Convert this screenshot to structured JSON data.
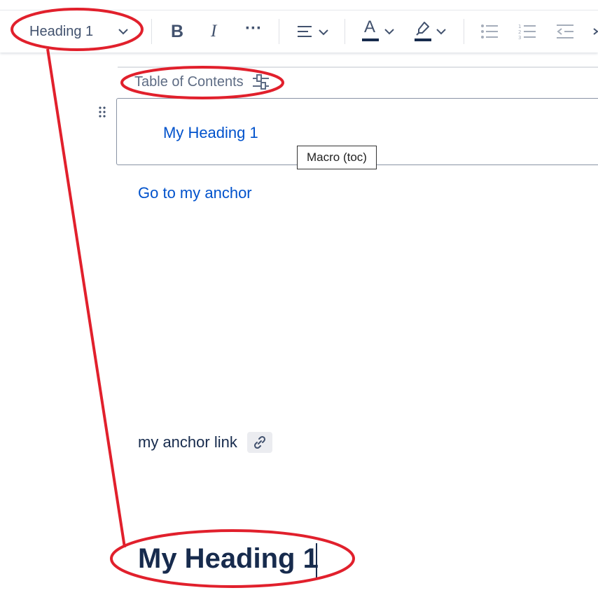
{
  "toolbar": {
    "style_dropdown_label": "Heading 1",
    "bold_label": "B",
    "italic_label": "I",
    "more_label": "···",
    "text_color_label": "A",
    "text_color_hex": "#172b4d",
    "highlight_color_hex": "#172b4d"
  },
  "editor": {
    "toc_macro_label": "Table of Contents",
    "toc_entries": [
      "My Heading 1"
    ],
    "tooltip": "Macro (toc)",
    "anchor_link_text": "Go to my anchor",
    "anchor_text": "my anchor link",
    "heading_text": "My Heading 1"
  },
  "colors": {
    "link": "#0052cc",
    "annotation": "#e1202c"
  }
}
